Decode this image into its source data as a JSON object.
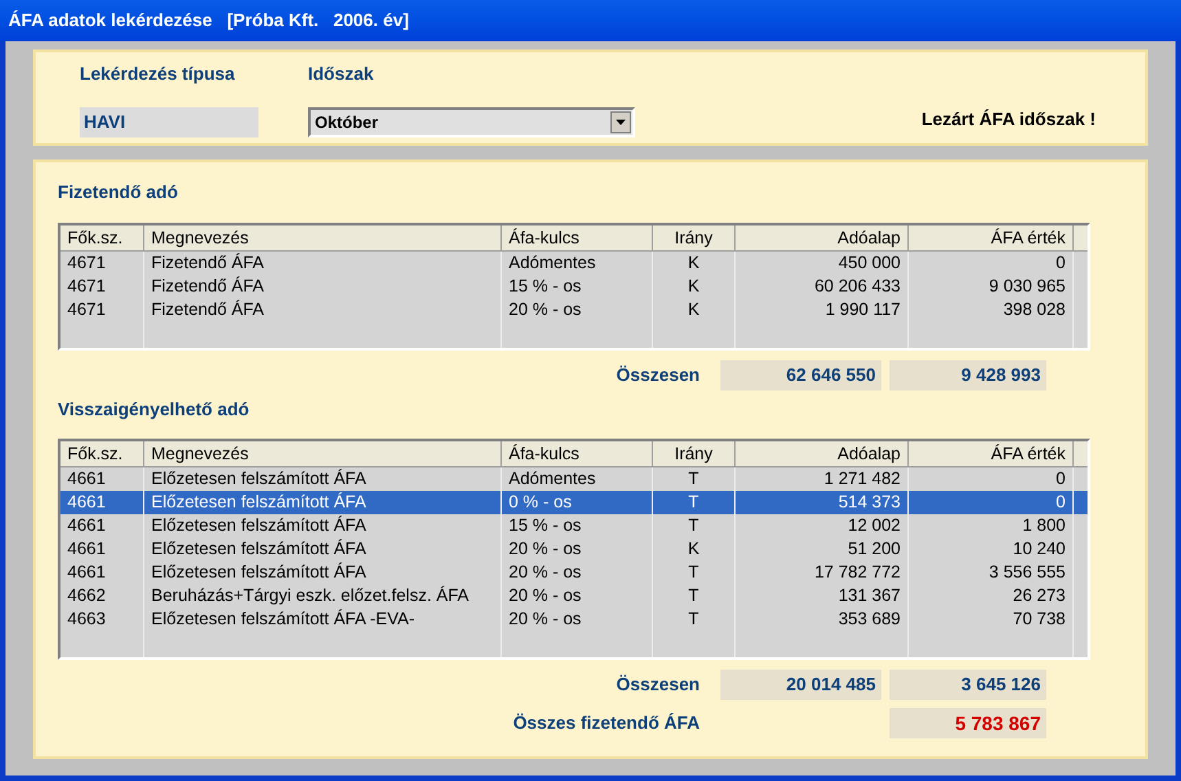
{
  "window": {
    "title": "ÁFA adatok lekérdezése   [Próba Kft.   2006. év]"
  },
  "query": {
    "type_label": "Lekérdezés típusa",
    "type_value": "HAVI",
    "period_label": "Időszak",
    "period_value": "Október",
    "status": "Lezárt ÁFA időszak !"
  },
  "tables": [
    {
      "title": "Fizetendő adó",
      "columns": [
        "Fők.sz.",
        "Megnevezés",
        "Áfa-kulcs",
        "Irány",
        "Adóalap",
        "ÁFA érték"
      ],
      "rows": [
        {
          "cells": [
            "4671",
            "Fizetendő ÁFA",
            "Adómentes",
            "K",
            "450 000",
            "0"
          ],
          "selected": false
        },
        {
          "cells": [
            "4671",
            "Fizetendő ÁFA",
            "15 % - os",
            "K",
            "60 206 433",
            "9 030 965"
          ],
          "selected": false
        },
        {
          "cells": [
            "4671",
            "Fizetendő ÁFA",
            "20 % - os",
            "K",
            "1 990 117",
            "398 028"
          ],
          "selected": false
        }
      ],
      "totals": [
        {
          "kind": "sum",
          "label": "Összesen",
          "values": [
            "62 646 550",
            "9 428 993"
          ]
        }
      ]
    },
    {
      "title": "Visszaigényelhető adó",
      "columns": [
        "Fők.sz.",
        "Megnevezés",
        "Áfa-kulcs",
        "Irány",
        "Adóalap",
        "ÁFA érték"
      ],
      "rows": [
        {
          "cells": [
            "4661",
            "Előzetesen felszámított ÁFA",
            "Adómentes",
            "T",
            "1 271 482",
            "0"
          ],
          "selected": false
        },
        {
          "cells": [
            "4661",
            "Előzetesen felszámított ÁFA",
            "0 % - os",
            "T",
            "514 373",
            "0"
          ],
          "selected": true
        },
        {
          "cells": [
            "4661",
            "Előzetesen felszámított ÁFA",
            "15 % - os",
            "T",
            "12 002",
            "1 800"
          ],
          "selected": false
        },
        {
          "cells": [
            "4661",
            "Előzetesen felszámított ÁFA",
            "20 % - os",
            "K",
            "51 200",
            "10 240"
          ],
          "selected": false
        },
        {
          "cells": [
            "4661",
            "Előzetesen felszámított ÁFA",
            "20 % - os",
            "T",
            "17 782 772",
            "3 556 555"
          ],
          "selected": false
        },
        {
          "cells": [
            "4662",
            "Beruházás+Tárgyi eszk. előzet.felsz. ÁFA",
            "20 % - os",
            "T",
            "131 367",
            "26 273"
          ],
          "selected": false
        },
        {
          "cells": [
            "4663",
            "Előzetesen felszámított ÁFA -EVA-",
            "20 % - os",
            "T",
            "353 689",
            "70 738"
          ],
          "selected": false
        }
      ],
      "totals": [
        {
          "kind": "sum",
          "label": "Összesen",
          "values": [
            "20 014 485",
            "3 645 126"
          ]
        },
        {
          "kind": "grand",
          "label": "Összes fizetendő ÁFA",
          "values": [
            "5 783 867"
          ]
        }
      ]
    }
  ]
}
